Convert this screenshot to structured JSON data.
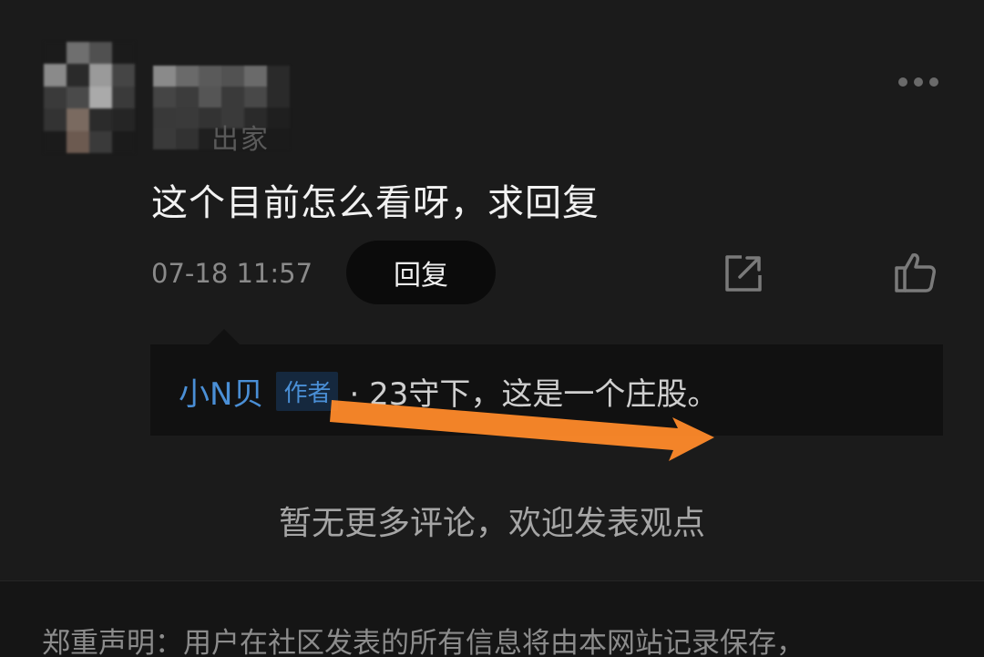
{
  "comment": {
    "username_partial": "出家",
    "text": "这个目前怎么看呀，求回复",
    "timestamp": "07-18 11:57",
    "reply_label": "回复"
  },
  "reply": {
    "author": "小N贝",
    "author_tag": "作者",
    "text": "· 23守下，这是一个庄股。"
  },
  "no_more_text": "暂无更多评论，欢迎发表观点",
  "footer": {
    "disclaimer": "郑重声明：用户在社区发表的所有信息将由本网站记录保存，"
  },
  "icons": {
    "more": "more-dots-icon",
    "share": "share-icon",
    "like": "thumbs-up-icon"
  },
  "colors": {
    "background": "#1b1b1b",
    "author_blue": "#4a8fd6",
    "arrow_orange": "#ff8a2a"
  }
}
